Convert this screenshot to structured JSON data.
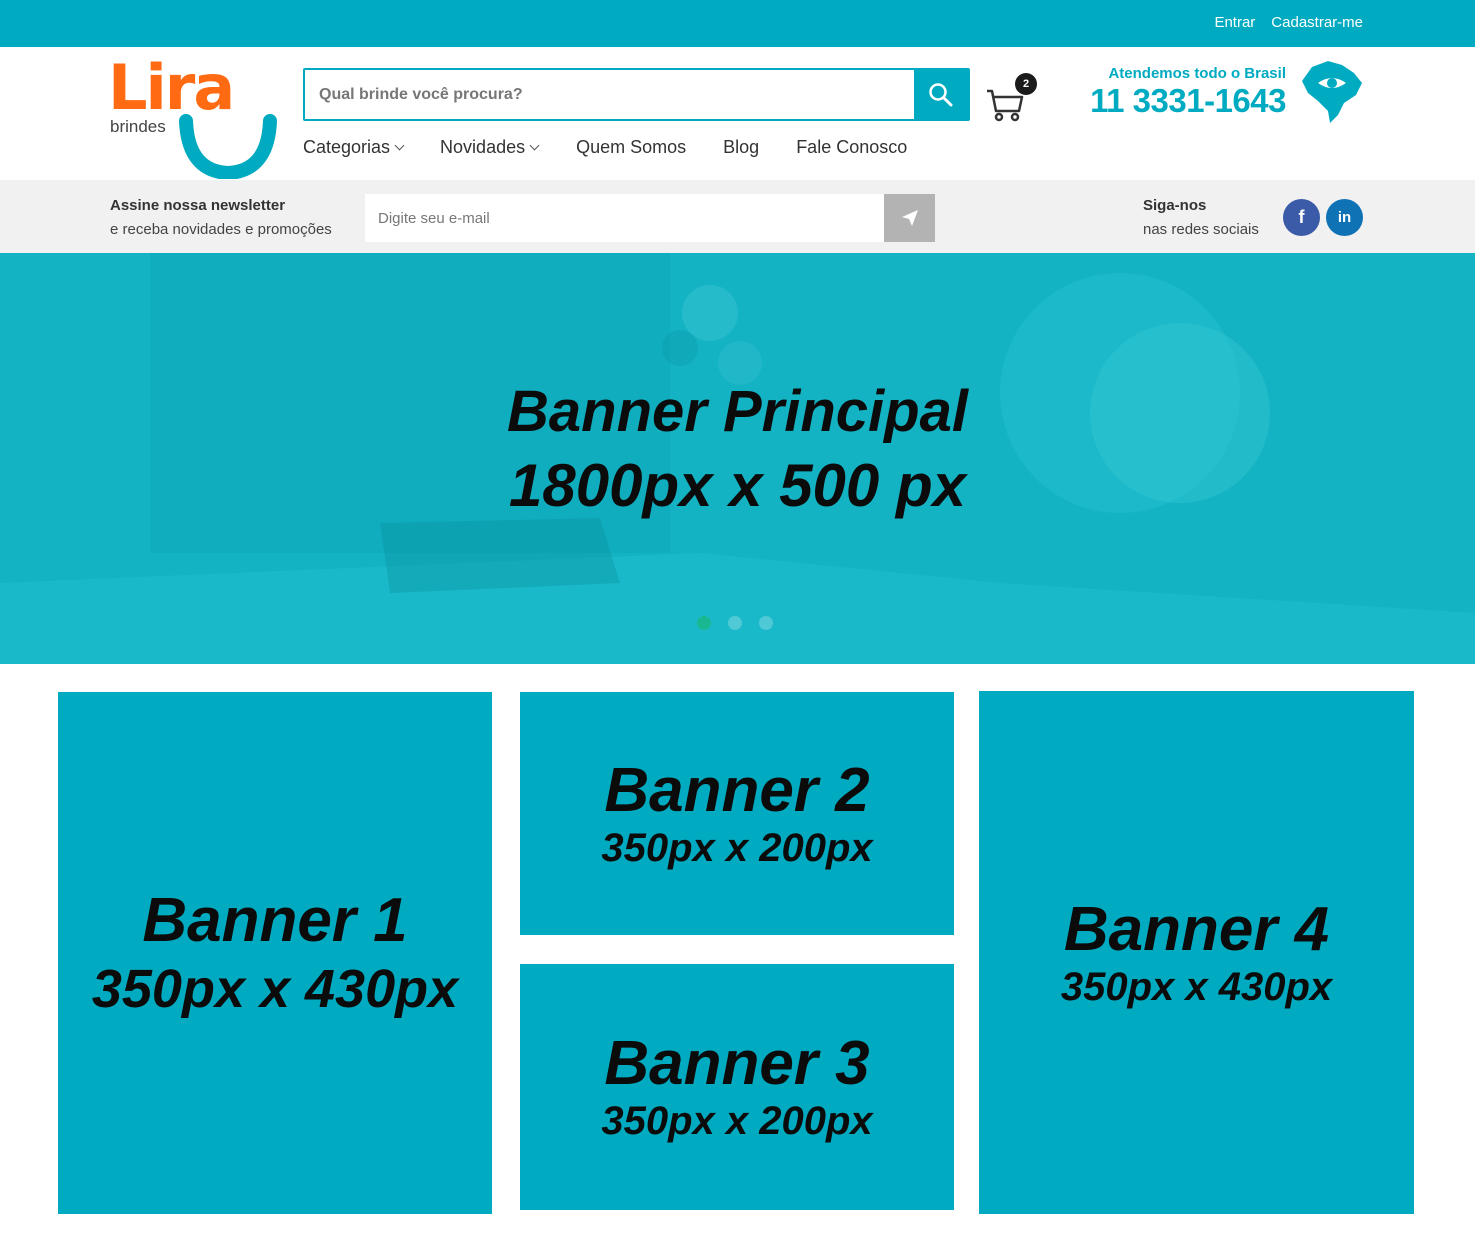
{
  "topbar": {
    "login": "Entrar",
    "register": "Cadastrar-me"
  },
  "header": {
    "logo_word": "Lira",
    "logo_sub": "brindes",
    "search_placeholder": "Qual brinde você procura?",
    "cart_count": "2",
    "contact_label": "Atendemos todo o Brasil",
    "contact_phone": "11 3331-1643"
  },
  "nav": {
    "items": [
      {
        "label": "Categorias"
      },
      {
        "label": "Novidades"
      },
      {
        "label": "Quem Somos"
      },
      {
        "label": "Blog"
      },
      {
        "label": "Fale Conosco"
      }
    ]
  },
  "newsletter": {
    "title": "Assine nossa newsletter",
    "subtitle": "e receba novidades e promoções",
    "email_placeholder": "Digite seu e-mail"
  },
  "social": {
    "title": "Siga-nos",
    "subtitle": "nas redes sociais",
    "facebook": "f",
    "linkedin": "in"
  },
  "hero": {
    "title": "Banner Principal",
    "size": "1800px x 500 px",
    "slides": 3,
    "active_slide": 1
  },
  "banners": [
    {
      "title": "Banner 1",
      "size": "350px x 430px"
    },
    {
      "title": "Banner 2",
      "size": "350px x 200px"
    },
    {
      "title": "Banner 3",
      "size": "350px x 200px"
    },
    {
      "title": "Banner 4",
      "size": "350px x 430px"
    }
  ],
  "colors": {
    "brand": "#00abc1",
    "logo_orange": "#ff6a13",
    "newsletter_bg": "#f1f1f1"
  }
}
